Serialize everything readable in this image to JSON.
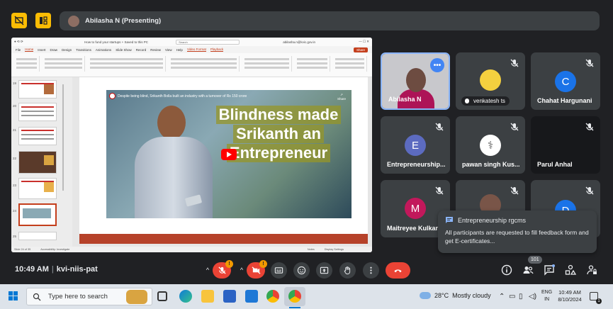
{
  "top_bar": {
    "presenter_label": "Abilasha N (Presenting)"
  },
  "shared_screen": {
    "window_title": "How to fund your startups + Saved to this PC",
    "search_placeholder": "Search",
    "user_email": "abilasha.n@kvic.gov.in",
    "ribbon_tabs": [
      "File",
      "Home",
      "Insert",
      "Draw",
      "Design",
      "Transitions",
      "Animations",
      "Slide Show",
      "Record",
      "Review",
      "View",
      "Help",
      "Video Format",
      "Playback"
    ],
    "share_button": "Share",
    "thumb_numbers": [
      "19",
      "20",
      "21",
      "22",
      "23",
      "24",
      "25"
    ],
    "video_title": "Despite being blind, Srikanth Bolla built an industry with a turnover of Rs 150 crore",
    "video_share": "Share",
    "headline_lines": [
      "Blindness made",
      "Srikanth an",
      "Entrepreneur"
    ],
    "status_left": "Slide 24 of 35",
    "status_accessibility": "Accessibility: Investigate",
    "status_notes": "Notes",
    "status_settings": "Display Settings"
  },
  "participants": [
    {
      "name": "Abilasha N",
      "muted": false,
      "type": "camera"
    },
    {
      "name": "venkatesh ts",
      "muted": true,
      "type": "avatar-image",
      "presenting_badge": true
    },
    {
      "name": "Chahat Hargunani",
      "muted": true,
      "type": "initial",
      "initial": "C",
      "color": "#1a73e8"
    },
    {
      "name": "Entrepreneurship...",
      "muted": true,
      "type": "initial",
      "initial": "E",
      "color": "#5c6bc0"
    },
    {
      "name": "pawan singh Kus...",
      "muted": true,
      "type": "avatar-image"
    },
    {
      "name": "Parul Anhal",
      "muted": true,
      "type": "black"
    },
    {
      "name": "Maitreyee Kulkarni",
      "muted": true,
      "type": "initial",
      "initial": "M",
      "color": "#c2185b"
    },
    {
      "name": "",
      "muted": true,
      "type": "avatar-image"
    },
    {
      "name": "",
      "muted": true,
      "type": "initial",
      "initial": "D",
      "color": "#1a73e8"
    }
  ],
  "chat_popup": {
    "sender": "Entrepreneurship rgcms",
    "message": "All participants are requested to fill feedback form and get E-certificates..."
  },
  "meeting_bar": {
    "time": "10:49 AM",
    "separator": "|",
    "meeting_code": "kvi-niis-pat",
    "warning_count": "!",
    "participant_count": "101"
  },
  "taskbar": {
    "search_placeholder": "Type here to search",
    "temperature": "28°C",
    "weather": "Mostly cloudy",
    "lang_line1": "ENG",
    "lang_line2": "IN",
    "clock_time": "10:49 AM",
    "clock_date": "8/10/2024",
    "notification_count": "1"
  },
  "colors": {
    "accent_yellow": "#fbbc04",
    "end_call_red": "#ea4335",
    "meet_dark": "#202124",
    "tile_gray": "#3c4043",
    "ppt_accent": "#c43e1c"
  }
}
